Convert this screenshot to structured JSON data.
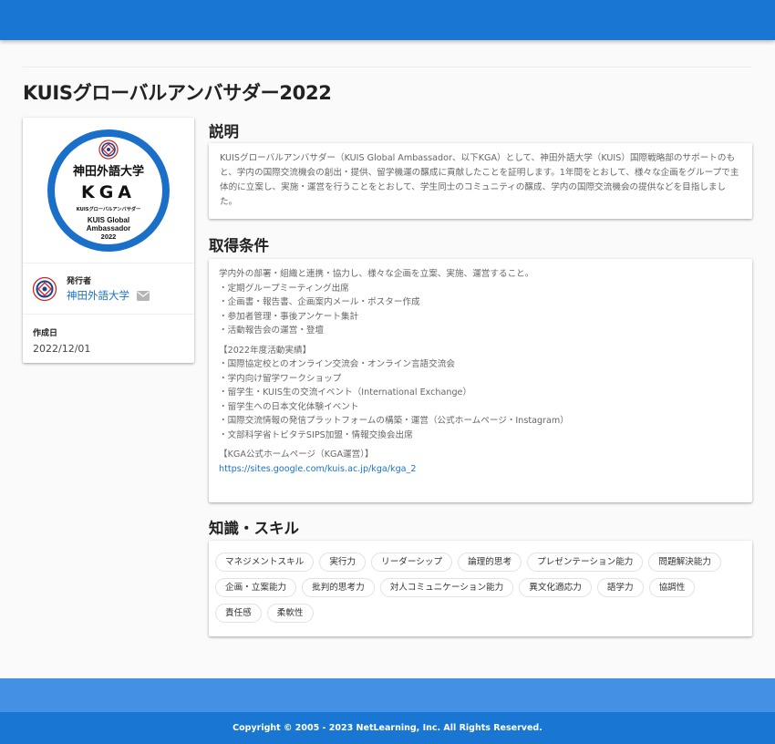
{
  "page": {
    "title": "KUISグローバルアンバサダー2022"
  },
  "badge": {
    "title_jp": "神田外語大学",
    "code": "KGA",
    "subtitle_jp": "KUISグローバルアンバサダー",
    "name_line1": "KUIS Global",
    "name_line2": "Ambassador",
    "year": "2022"
  },
  "issuer": {
    "label": "発行者",
    "name": "神田外語大学"
  },
  "created": {
    "label": "作成日",
    "date": "2022/12/01"
  },
  "sections": {
    "description_heading": "説明",
    "requirements_heading": "取得条件",
    "skills_heading": "知識・スキル"
  },
  "description": {
    "text": "KUISグローバルアンバサダー（KUIS Global Ambassador、以下KGA）として、神田外語大学（KUIS）国際戦略部のサポートのもと、学内の国際交流機会の創出・提供、留学機運の醸成に貢献したことを証明します。1年間をとおして、様々な企画をグループで主体的に立案し、実施・運営を行うことをとおして、学生同士のコミュニティの醸成、学内の国際交流機会の提供などを目指しました。"
  },
  "requirements": {
    "intro": "学内外の部署・組織と連携・協力し、様々な企画を立案、実施、運営すること。",
    "items": [
      "・定期グループミーティング出席",
      "・企画書・報告書、企画案内メール・ポスター作成",
      "・参加者管理・事後アンケート集計",
      "・活動報告会の運営・登壇"
    ],
    "results_heading": "【2022年度活動実績】",
    "results": [
      "・国際協定校とのオンライン交流会・オンライン言語交流会",
      "・学内向け留学ワークショップ",
      "・留学生・KUIS生の交流イベント（International Exchange）",
      "・留学生への日本文化体験イベント",
      "・国際交流情報の発信プラットフォームの構築・運営（公式ホームページ・Instagram）",
      "・文部科学省トビタテSIPS加盟・情報交換会出席"
    ],
    "homepage_heading": "【KGA公式ホームページ（KGA運営）】",
    "homepage_url": "https://sites.google.com/kuis.ac.jp/kga/kga_2"
  },
  "skills": [
    "マネジメントスキル",
    "実行力",
    "リーダーシップ",
    "論理的思考",
    "プレゼンテーション能力",
    "問題解決能力",
    "企画・立案能力",
    "批判的思考力",
    "対人コミュニケーション能力",
    "異文化適応力",
    "語学力",
    "協調性",
    "責任感",
    "柔軟性"
  ],
  "footer": {
    "copyright": "Copyright © 2005 - 2023 NetLearning, Inc. All Rights Reserved."
  },
  "colors": {
    "primary": "#1976d2",
    "footer_light": "#4490e4",
    "link": "#1a73c8",
    "badge_ring": "#1a6fc9"
  }
}
